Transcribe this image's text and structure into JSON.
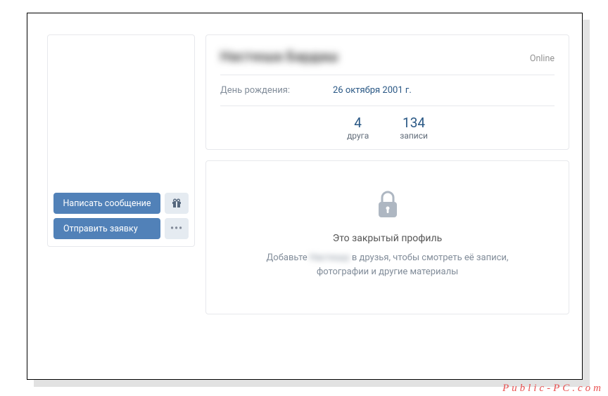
{
  "sidebar": {
    "message_btn": "Написать сообщение",
    "request_btn": "Отправить заявку"
  },
  "profile": {
    "name": "Настюша Бардаш",
    "status": "Online",
    "birthday_label": "День рождения:",
    "birthday_value": "26 октября 2001 г."
  },
  "counters": [
    {
      "num": "4",
      "label": "друга"
    },
    {
      "num": "134",
      "label": "записи"
    }
  ],
  "locked": {
    "title": "Это закрытый профиль",
    "desc_prefix": "Добавьте ",
    "desc_blurred": "Настюшу",
    "desc_suffix": " в друзья, чтобы смотреть её записи,",
    "desc_line2": "фотографии и другие материалы"
  },
  "watermark": "Public-PC.com"
}
